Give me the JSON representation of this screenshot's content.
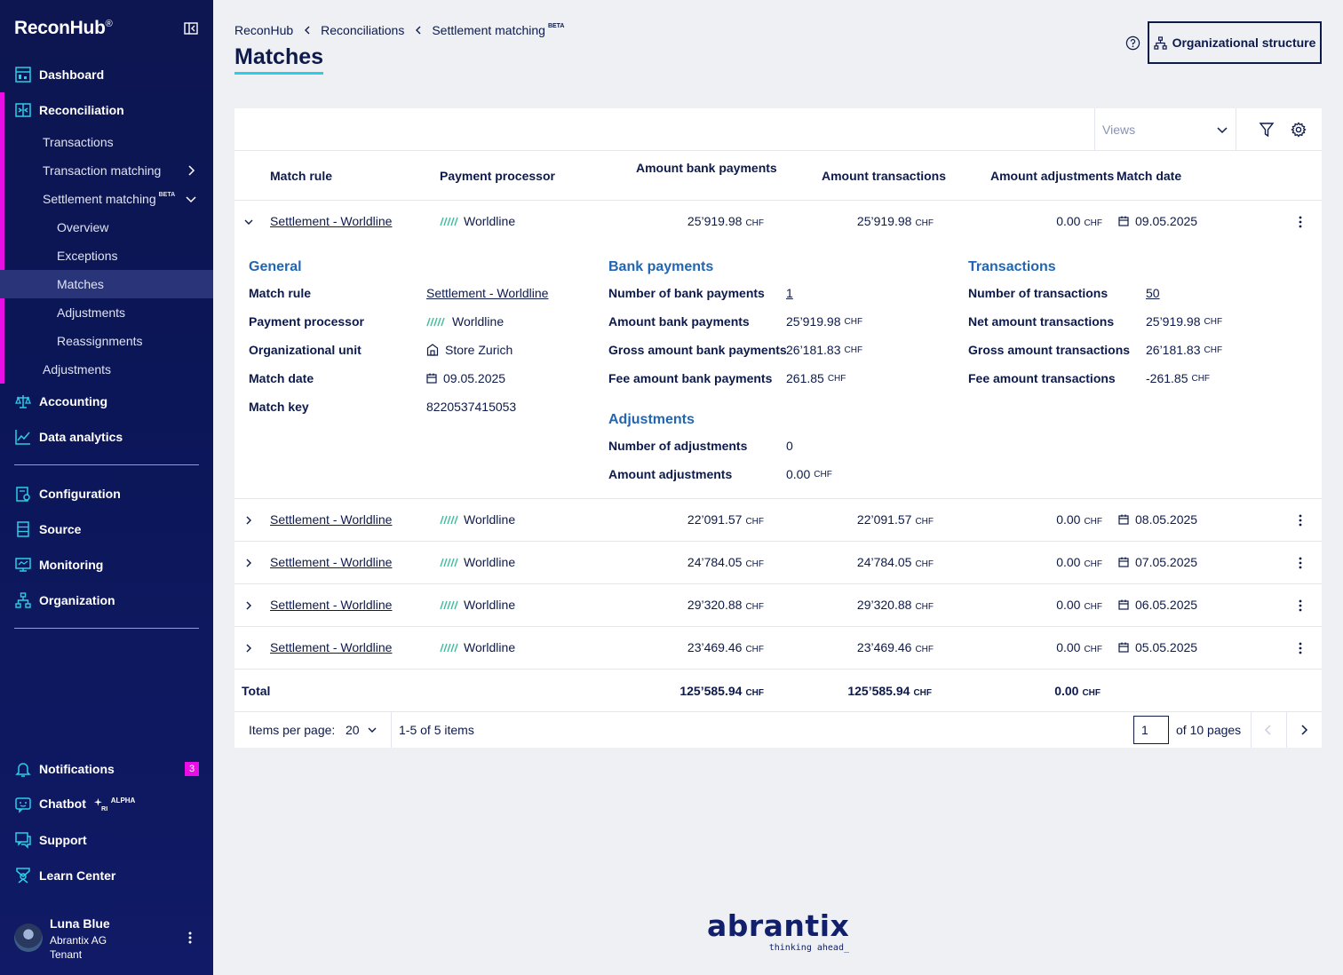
{
  "app": {
    "name": "ReconHub",
    "mark": "®"
  },
  "sidebar": {
    "nav": {
      "dashboard": "Dashboard",
      "reconciliation": "Reconciliation",
      "accounting": "Accounting",
      "data_analytics": "Data analytics",
      "configuration": "Configuration",
      "source": "Source",
      "monitoring": "Monitoring",
      "organization": "Organization",
      "notifications": "Notifications",
      "chatbot": "Chatbot",
      "chatbot_sup": "ALPHA",
      "support": "Support",
      "learn_center": "Learn Center"
    },
    "reconciliation_sub": {
      "transactions": "Transactions",
      "transaction_matching": "Transaction matching",
      "settlement_matching": "Settlement matching",
      "settlement_matching_sup": "BETA",
      "overview": "Overview",
      "exceptions": "Exceptions",
      "matches": "Matches",
      "adjustments_nested": "Adjustments",
      "reassignments": "Reassignments",
      "adjustments": "Adjustments"
    },
    "notifications_count": "3",
    "user": {
      "name": "Luna Blue",
      "org": "Abrantix AG",
      "role": "Tenant"
    }
  },
  "breadcrumb": {
    "items": [
      "ReconHub",
      "Reconciliations",
      "Settlement matching"
    ],
    "last_sup": "BETA"
  },
  "page_title": "Matches",
  "org_button": "Organizational structure",
  "toolbar": {
    "views_placeholder": "Views"
  },
  "table": {
    "headers": {
      "match_rule": "Match rule",
      "payment_processor": "Payment processor",
      "amount_bank_payments": "Amount bank payments",
      "amount_transactions": "Amount transactions",
      "amount_adjustments": "Amount adjustments",
      "match_date": "Match date"
    },
    "currency": "CHF",
    "rows": [
      {
        "rule": "Settlement - Worldline",
        "processor": "Worldline",
        "bank": "25’919.98",
        "trans": "25’919.98",
        "adj": "0.00",
        "date": "09.05.2025"
      },
      {
        "rule": "Settlement - Worldline",
        "processor": "Worldline",
        "bank": "22’091.57",
        "trans": "22’091.57",
        "adj": "0.00",
        "date": "08.05.2025"
      },
      {
        "rule": "Settlement - Worldline",
        "processor": "Worldline",
        "bank": "24’784.05",
        "trans": "24’784.05",
        "adj": "0.00",
        "date": "07.05.2025"
      },
      {
        "rule": "Settlement - Worldline",
        "processor": "Worldline",
        "bank": "29’320.88",
        "trans": "29’320.88",
        "adj": "0.00",
        "date": "06.05.2025"
      },
      {
        "rule": "Settlement - Worldline",
        "processor": "Worldline",
        "bank": "23’469.46",
        "trans": "23’469.46",
        "adj": "0.00",
        "date": "05.05.2025"
      }
    ],
    "total": {
      "label": "Total",
      "bank": "125’585.94",
      "trans": "125’585.94",
      "adj": "0.00"
    }
  },
  "detail": {
    "general": {
      "title": "General",
      "match_rule_label": "Match rule",
      "match_rule": "Settlement - Worldline",
      "processor_label": "Payment processor",
      "processor": "Worldline",
      "org_unit_label": "Organizational unit",
      "org_unit": "Store Zurich",
      "match_date_label": "Match date",
      "match_date": "09.05.2025",
      "match_key_label": "Match key",
      "match_key": "8220537415053"
    },
    "bank_payments": {
      "title": "Bank payments",
      "count_label": "Number of bank payments",
      "count": "1",
      "amount_label": "Amount bank payments",
      "amount": "25’919.98",
      "gross_label": "Gross amount bank payments",
      "gross": "26’181.83",
      "fee_label": "Fee amount bank payments",
      "fee": "261.85"
    },
    "adjustments": {
      "title": "Adjustments",
      "count_label": "Number of adjustments",
      "count": "0",
      "amount_label": "Amount adjustments",
      "amount": "0.00"
    },
    "transactions": {
      "title": "Transactions",
      "count_label": "Number of transactions",
      "count": "50",
      "net_label": "Net amount transactions",
      "net": "25’919.98",
      "gross_label": "Gross amount transactions",
      "gross": "26’181.83",
      "fee_label": "Fee amount transactions",
      "fee": "-261.85"
    }
  },
  "pagination": {
    "items_per_page_label": "Items per page:",
    "items_per_page": "20",
    "range": "1-5 of 5 items",
    "page": "1",
    "of_pages": "of 10 pages"
  },
  "brand": {
    "name": "abrantix",
    "tagline": "thinking ahead_"
  },
  "colors": {
    "accent_cyan": "#2ccde8",
    "accent_pink": "#e90ee6",
    "navy": "#0d1a4a",
    "link_blue": "#2266b3"
  }
}
